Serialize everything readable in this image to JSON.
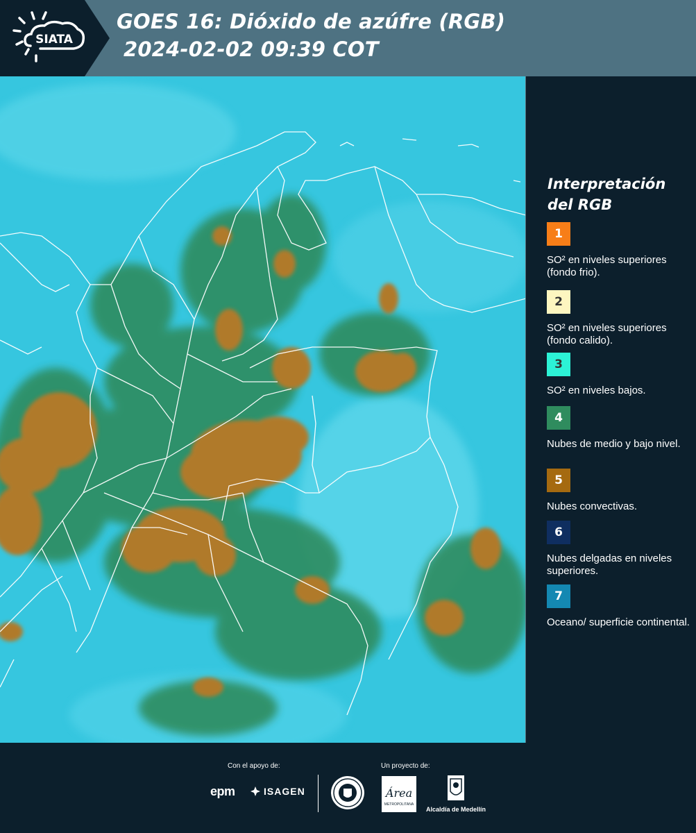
{
  "header": {
    "title_line1": "GOES 16: Dióxido de azúfre (RGB)",
    "title_line2": "2024-02-02 09:39 COT",
    "logo_text": "SIATA",
    "logo_icon": "sun-cloud-icon"
  },
  "legend": {
    "title": "Interpretación del RGB",
    "items": [
      {
        "number": "1",
        "color": "#f77e18",
        "number_color": "#ffffff",
        "label": "SO² en niveles superiores (fondo frio)."
      },
      {
        "number": "2",
        "color": "#fdf6c0",
        "number_color": "#333333",
        "label": "SO² en niveles superiores (fondo calido)."
      },
      {
        "number": "3",
        "color": "#2cf2d6",
        "number_color": "#333333",
        "label": "SO² en niveles bajos."
      },
      {
        "number": "4",
        "color": "#2f8c5e",
        "number_color": "#ffffff",
        "label": "Nubes de medio y bajo nivel."
      },
      {
        "number": "5",
        "color": "#a56a10",
        "number_color": "#ffffff",
        "label": "Nubes convectivas."
      },
      {
        "number": "6",
        "color": "#0f2e60",
        "number_color": "#ffffff",
        "label": "Nubes delgadas en niveles superiores."
      },
      {
        "number": "7",
        "color": "#1488b2",
        "number_color": "#ffffff",
        "label": "Oceano/ superficie continental."
      }
    ]
  },
  "map": {
    "background_color": "#38c8e0",
    "convective_color": "#b07a2c",
    "cloud_color": "#2f8c5e",
    "border_color": "#ffffff"
  },
  "footer": {
    "sponsor_label": "Con el apoyo de:",
    "project_label": "Un proyecto de:",
    "epm_text": "epm",
    "isagen_text": "ISAGEN",
    "area_text": "Área",
    "area_subtext": "METROPOLITANA",
    "medellin_text": "Alcaldía de Medellín"
  }
}
